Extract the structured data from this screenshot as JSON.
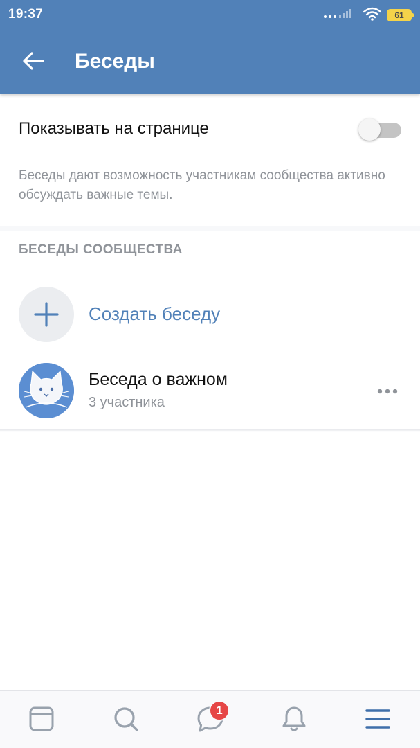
{
  "status_bar": {
    "time": "19:37",
    "battery": "61"
  },
  "header": {
    "title": "Беседы",
    "back_icon": "arrow-left-icon",
    "color": "#5181b8"
  },
  "settings": {
    "toggle_label": "Показывать на странице",
    "toggle_on": false,
    "description": "Беседы дают возможность участникам сообщества активно обсуждать важные темы."
  },
  "section": {
    "header": "БЕСЕДЫ СООБЩЕСТВА",
    "create_label": "Создать беседу",
    "create_icon": "plus-icon"
  },
  "chats": [
    {
      "title": "Беседа о важном",
      "subtitle": "3 участника",
      "avatar": "cat-avatar",
      "more_icon": "more-horizontal-icon"
    }
  ],
  "bottom_nav": {
    "items": [
      {
        "name": "news",
        "icon": "newsfeed-icon"
      },
      {
        "name": "search",
        "icon": "search-icon"
      },
      {
        "name": "messages",
        "icon": "message-icon",
        "badge": "1"
      },
      {
        "name": "notifications",
        "icon": "bell-icon"
      },
      {
        "name": "menu",
        "icon": "menu-icon",
        "active": true
      }
    ],
    "active_color": "#3f6faa",
    "inactive_color": "#99a2ad"
  }
}
